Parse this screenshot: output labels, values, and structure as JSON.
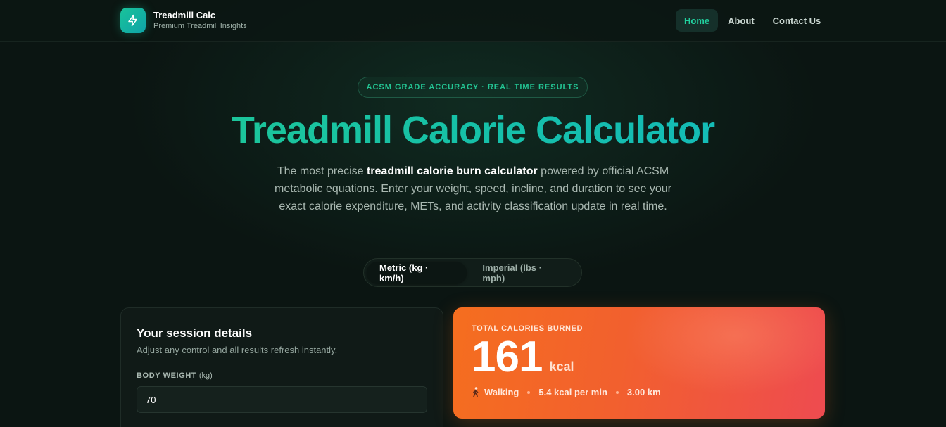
{
  "header": {
    "brand_title": "Treadmill Calc",
    "brand_subtitle": "Premium Treadmill Insights",
    "logo_icon": "lightning-bolt-icon",
    "nav": [
      {
        "label": "Home",
        "active": true
      },
      {
        "label": "About",
        "active": false
      },
      {
        "label": "Contact Us",
        "active": false
      }
    ]
  },
  "hero": {
    "badge": "ACSM GRADE ACCURACY · REAL TIME RESULTS",
    "title": "Treadmill Calorie Calculator",
    "desc_prefix": "The most precise ",
    "desc_bold": "treadmill calorie burn calculator",
    "desc_suffix": " powered by official ACSM metabolic equations. Enter your weight, speed, incline, and duration to see your exact calorie expenditure, METs, and activity classification update in real time."
  },
  "units": {
    "metric": "Metric (kg · km/h)",
    "imperial": "Imperial (lbs · mph)",
    "selected": "metric"
  },
  "session": {
    "title": "Your session details",
    "subtitle": "Adjust any control and all results refresh instantly.",
    "weight_label": "BODY WEIGHT",
    "weight_unit": "(kg)",
    "weight_value": "70"
  },
  "results": {
    "label": "TOTAL CALORIES BURNED",
    "calories": "161",
    "unit": "kcal",
    "activity": "Walking",
    "rate": "5.4 kcal per min",
    "distance": "3.00 km"
  },
  "colors": {
    "accent": "#21d19f",
    "background": "#0b1512",
    "result_orange": "#f56e1f",
    "result_red": "#ee4b50"
  }
}
